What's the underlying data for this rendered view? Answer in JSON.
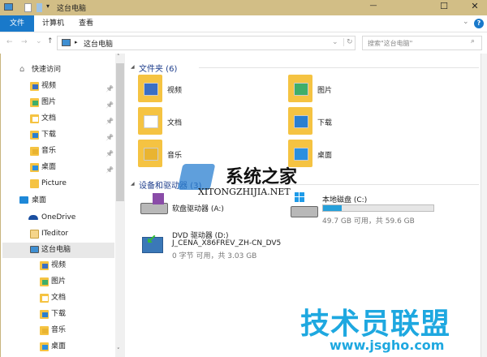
{
  "window": {
    "title": "这台电脑",
    "minimize": "—",
    "maximize": "☐",
    "close": "✕"
  },
  "ribbon": {
    "tabs": [
      {
        "label": "文件"
      },
      {
        "label": "计算机"
      },
      {
        "label": "查看"
      }
    ],
    "expand": "⌄",
    "help": "?"
  },
  "address": {
    "back": "←",
    "forward": "→",
    "recent": "⌄",
    "up": "↑",
    "separator": "▸",
    "path": "这台电脑",
    "dropdown": "⌄",
    "refresh": "↻",
    "search_placeholder": "搜索\"这台电脑\"",
    "search_icon": "⌕"
  },
  "sidebar": {
    "quick_access": "快速访问",
    "quick_items": [
      {
        "label": "视频",
        "color": "#3a6fc4",
        "pinned": true
      },
      {
        "label": "图片",
        "color": "#3fae6a",
        "pinned": true
      },
      {
        "label": "文档",
        "color": "#ffffff",
        "pinned": true
      },
      {
        "label": "下载",
        "color": "#2a7fd0",
        "pinned": true
      },
      {
        "label": "音乐",
        "color": "#e9b431",
        "pinned": true
      },
      {
        "label": "桌面",
        "color": "#2a8fe0",
        "pinned": true
      },
      {
        "label": "Picture",
        "color": "#f5c342",
        "pinned": false
      }
    ],
    "desktop": "桌面",
    "onedrive": "OneDrive",
    "iteditor": "ITeditor",
    "this_pc": "这台电脑",
    "pc_items": [
      {
        "label": "视频",
        "color": "#3a6fc4"
      },
      {
        "label": "图片",
        "color": "#3fae6a"
      },
      {
        "label": "文档",
        "color": "#ffffff"
      },
      {
        "label": "下载",
        "color": "#2a7fd0"
      },
      {
        "label": "音乐",
        "color": "#e9b431"
      },
      {
        "label": "桌面",
        "color": "#2a8fe0"
      }
    ],
    "pin_glyph": "📌"
  },
  "folders": {
    "header": "文件夹 (6)",
    "items": [
      {
        "label": "视频",
        "color": "#3a6fc4"
      },
      {
        "label": "图片",
        "color": "#3fae6a"
      },
      {
        "label": "文档",
        "color": "#ffffff"
      },
      {
        "label": "下载",
        "color": "#2a7fd0"
      },
      {
        "label": "音乐",
        "color": "#e9b431"
      },
      {
        "label": "桌面",
        "color": "#2a8fe0"
      }
    ]
  },
  "devices": {
    "header": "设备和驱动器 (3)",
    "items": [
      {
        "name": "软盘驱动器 (A:)"
      },
      {
        "name": "本地磁盘 (C:)",
        "used_percent": 16.6,
        "free": "49.7 GB 可用，共 59.6 GB"
      },
      {
        "name": "DVD 驱动器 (D:)",
        "label": "J_CENA_X86FREV_ZH-CN_DV5",
        "free": "0 字节 可用，共 3.03 GB"
      }
    ]
  },
  "watermarks": {
    "top": "系统之家",
    "top_url": "XITONGZHIJIA.NET",
    "bottom": "技术员联盟",
    "bottom_url": "www.jsgho.com"
  },
  "colors": {
    "accent": "#1979ca",
    "title_bar": "#d2be86",
    "progress": "#26a0da"
  }
}
